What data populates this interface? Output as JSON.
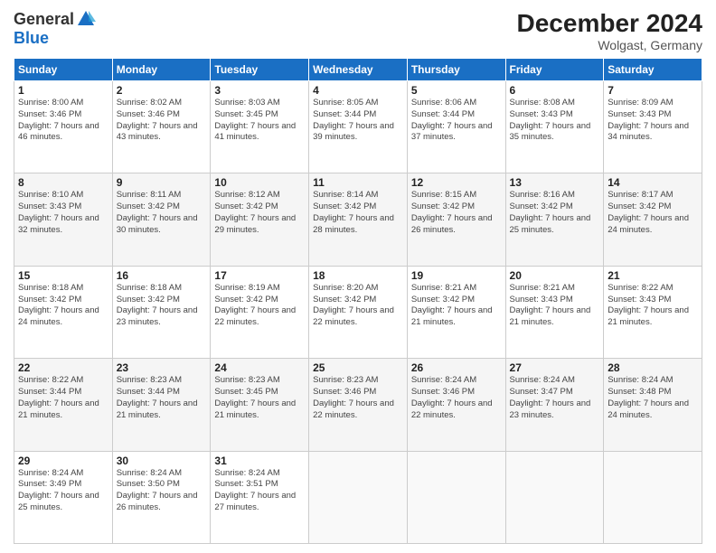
{
  "logo": {
    "general": "General",
    "blue": "Blue"
  },
  "title": "December 2024",
  "location": "Wolgast, Germany",
  "days_header": [
    "Sunday",
    "Monday",
    "Tuesday",
    "Wednesday",
    "Thursday",
    "Friday",
    "Saturday"
  ],
  "weeks": [
    [
      {
        "day": "1",
        "sunrise": "Sunrise: 8:00 AM",
        "sunset": "Sunset: 3:46 PM",
        "daylight": "Daylight: 7 hours and 46 minutes."
      },
      {
        "day": "2",
        "sunrise": "Sunrise: 8:02 AM",
        "sunset": "Sunset: 3:46 PM",
        "daylight": "Daylight: 7 hours and 43 minutes."
      },
      {
        "day": "3",
        "sunrise": "Sunrise: 8:03 AM",
        "sunset": "Sunset: 3:45 PM",
        "daylight": "Daylight: 7 hours and 41 minutes."
      },
      {
        "day": "4",
        "sunrise": "Sunrise: 8:05 AM",
        "sunset": "Sunset: 3:44 PM",
        "daylight": "Daylight: 7 hours and 39 minutes."
      },
      {
        "day": "5",
        "sunrise": "Sunrise: 8:06 AM",
        "sunset": "Sunset: 3:44 PM",
        "daylight": "Daylight: 7 hours and 37 minutes."
      },
      {
        "day": "6",
        "sunrise": "Sunrise: 8:08 AM",
        "sunset": "Sunset: 3:43 PM",
        "daylight": "Daylight: 7 hours and 35 minutes."
      },
      {
        "day": "7",
        "sunrise": "Sunrise: 8:09 AM",
        "sunset": "Sunset: 3:43 PM",
        "daylight": "Daylight: 7 hours and 34 minutes."
      }
    ],
    [
      {
        "day": "8",
        "sunrise": "Sunrise: 8:10 AM",
        "sunset": "Sunset: 3:43 PM",
        "daylight": "Daylight: 7 hours and 32 minutes."
      },
      {
        "day": "9",
        "sunrise": "Sunrise: 8:11 AM",
        "sunset": "Sunset: 3:42 PM",
        "daylight": "Daylight: 7 hours and 30 minutes."
      },
      {
        "day": "10",
        "sunrise": "Sunrise: 8:12 AM",
        "sunset": "Sunset: 3:42 PM",
        "daylight": "Daylight: 7 hours and 29 minutes."
      },
      {
        "day": "11",
        "sunrise": "Sunrise: 8:14 AM",
        "sunset": "Sunset: 3:42 PM",
        "daylight": "Daylight: 7 hours and 28 minutes."
      },
      {
        "day": "12",
        "sunrise": "Sunrise: 8:15 AM",
        "sunset": "Sunset: 3:42 PM",
        "daylight": "Daylight: 7 hours and 26 minutes."
      },
      {
        "day": "13",
        "sunrise": "Sunrise: 8:16 AM",
        "sunset": "Sunset: 3:42 PM",
        "daylight": "Daylight: 7 hours and 25 minutes."
      },
      {
        "day": "14",
        "sunrise": "Sunrise: 8:17 AM",
        "sunset": "Sunset: 3:42 PM",
        "daylight": "Daylight: 7 hours and 24 minutes."
      }
    ],
    [
      {
        "day": "15",
        "sunrise": "Sunrise: 8:18 AM",
        "sunset": "Sunset: 3:42 PM",
        "daylight": "Daylight: 7 hours and 24 minutes."
      },
      {
        "day": "16",
        "sunrise": "Sunrise: 8:18 AM",
        "sunset": "Sunset: 3:42 PM",
        "daylight": "Daylight: 7 hours and 23 minutes."
      },
      {
        "day": "17",
        "sunrise": "Sunrise: 8:19 AM",
        "sunset": "Sunset: 3:42 PM",
        "daylight": "Daylight: 7 hours and 22 minutes."
      },
      {
        "day": "18",
        "sunrise": "Sunrise: 8:20 AM",
        "sunset": "Sunset: 3:42 PM",
        "daylight": "Daylight: 7 hours and 22 minutes."
      },
      {
        "day": "19",
        "sunrise": "Sunrise: 8:21 AM",
        "sunset": "Sunset: 3:42 PM",
        "daylight": "Daylight: 7 hours and 21 minutes."
      },
      {
        "day": "20",
        "sunrise": "Sunrise: 8:21 AM",
        "sunset": "Sunset: 3:43 PM",
        "daylight": "Daylight: 7 hours and 21 minutes."
      },
      {
        "day": "21",
        "sunrise": "Sunrise: 8:22 AM",
        "sunset": "Sunset: 3:43 PM",
        "daylight": "Daylight: 7 hours and 21 minutes."
      }
    ],
    [
      {
        "day": "22",
        "sunrise": "Sunrise: 8:22 AM",
        "sunset": "Sunset: 3:44 PM",
        "daylight": "Daylight: 7 hours and 21 minutes."
      },
      {
        "day": "23",
        "sunrise": "Sunrise: 8:23 AM",
        "sunset": "Sunset: 3:44 PM",
        "daylight": "Daylight: 7 hours and 21 minutes."
      },
      {
        "day": "24",
        "sunrise": "Sunrise: 8:23 AM",
        "sunset": "Sunset: 3:45 PM",
        "daylight": "Daylight: 7 hours and 21 minutes."
      },
      {
        "day": "25",
        "sunrise": "Sunrise: 8:23 AM",
        "sunset": "Sunset: 3:46 PM",
        "daylight": "Daylight: 7 hours and 22 minutes."
      },
      {
        "day": "26",
        "sunrise": "Sunrise: 8:24 AM",
        "sunset": "Sunset: 3:46 PM",
        "daylight": "Daylight: 7 hours and 22 minutes."
      },
      {
        "day": "27",
        "sunrise": "Sunrise: 8:24 AM",
        "sunset": "Sunset: 3:47 PM",
        "daylight": "Daylight: 7 hours and 23 minutes."
      },
      {
        "day": "28",
        "sunrise": "Sunrise: 8:24 AM",
        "sunset": "Sunset: 3:48 PM",
        "daylight": "Daylight: 7 hours and 24 minutes."
      }
    ],
    [
      {
        "day": "29",
        "sunrise": "Sunrise: 8:24 AM",
        "sunset": "Sunset: 3:49 PM",
        "daylight": "Daylight: 7 hours and 25 minutes."
      },
      {
        "day": "30",
        "sunrise": "Sunrise: 8:24 AM",
        "sunset": "Sunset: 3:50 PM",
        "daylight": "Daylight: 7 hours and 26 minutes."
      },
      {
        "day": "31",
        "sunrise": "Sunrise: 8:24 AM",
        "sunset": "Sunset: 3:51 PM",
        "daylight": "Daylight: 7 hours and 27 minutes."
      },
      null,
      null,
      null,
      null
    ]
  ]
}
